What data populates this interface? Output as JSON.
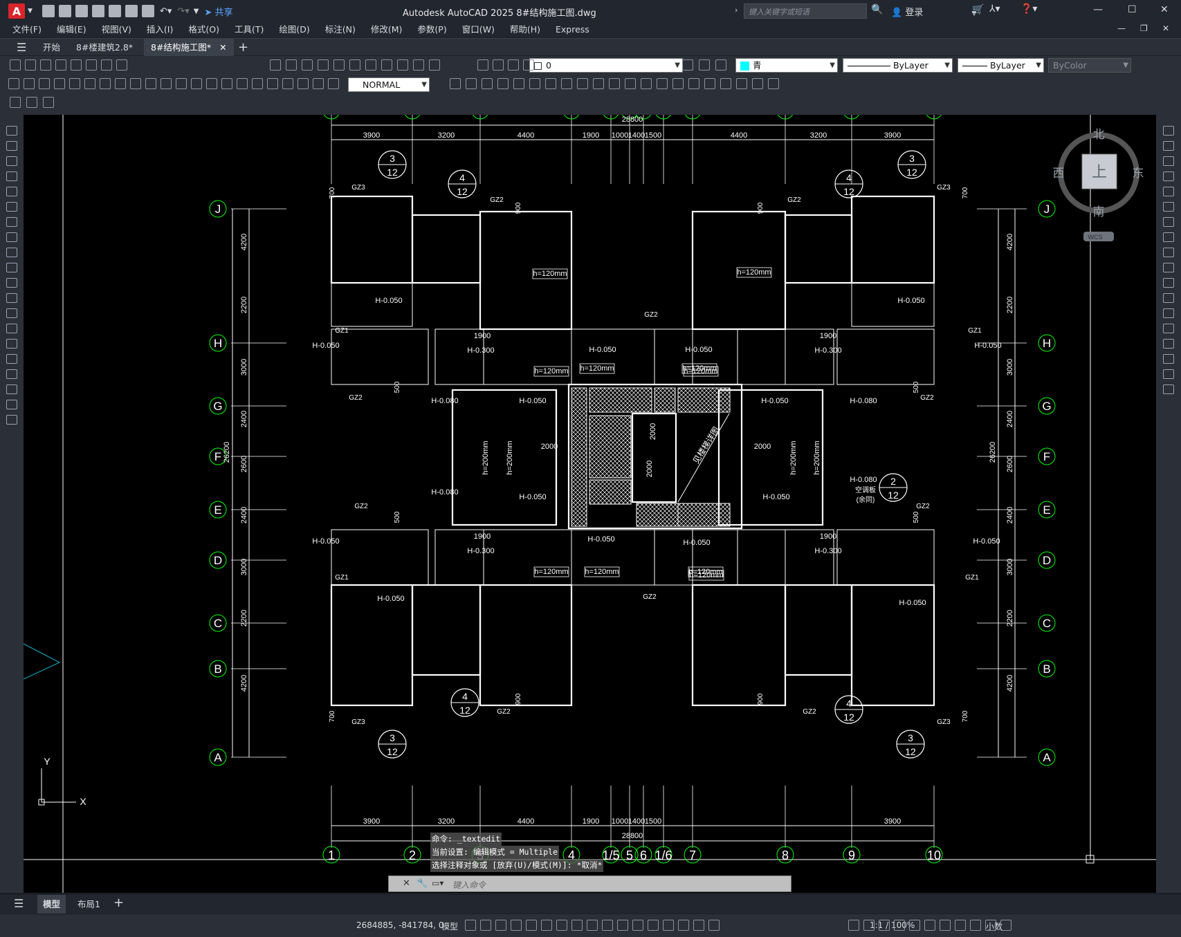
{
  "app": {
    "title": "Autodesk AutoCAD 2025    8#结构施工图.dwg",
    "logo": "A",
    "share_label": "共享",
    "search_placeholder": "键入关键字或短语",
    "login_label": "登录"
  },
  "menu": [
    "文件(F)",
    "编辑(E)",
    "视图(V)",
    "插入(I)",
    "格式(O)",
    "工具(T)",
    "绘图(D)",
    "标注(N)",
    "修改(M)",
    "参数(P)",
    "窗口(W)",
    "帮助(H)",
    "Express"
  ],
  "tabs": [
    {
      "label": "开始"
    },
    {
      "label": "8#楼建筑2.8*"
    },
    {
      "label": "8#结构施工图*"
    }
  ],
  "toolbar": {
    "layer_value": "0",
    "textstyle_value": "NORMAL",
    "color_value": "青",
    "linetype_value": "ByLayer",
    "lineweight_value": "ByLayer",
    "plotstyle_value": "ByColor"
  },
  "viewcube": {
    "north": "北",
    "south": "南",
    "east": "东",
    "west": "西",
    "top": "上",
    "wcs": "WCS"
  },
  "drawing": {
    "grid_v": [
      "1",
      "2",
      "3",
      "4",
      "1/5",
      "5",
      "6",
      "1/6",
      "7",
      "8",
      "9",
      "10"
    ],
    "grid_h": [
      "J",
      "H",
      "G",
      "F",
      "E",
      "D",
      "C",
      "B",
      "A"
    ],
    "top_dims": [
      "3900",
      "3200",
      "4400",
      "1900",
      "1000",
      "1400",
      "1500",
      "4400",
      "3200",
      "3900"
    ],
    "bottom_dims": [
      "3900",
      "3200",
      "4400",
      "1900",
      "1000",
      "1400",
      "1500",
      "3900"
    ],
    "total_width": "28800",
    "total_height": "26200",
    "left_dims": [
      "4200",
      "2200",
      "3000",
      "2400",
      "2600",
      "2400",
      "3000",
      "2200",
      "4200"
    ],
    "slab_labels": [
      "h=120mm",
      "h=200mm",
      "H-0.050",
      "H-0.300",
      "H-0.080",
      "GZ1",
      "GZ2",
      "GZ3",
      "1900",
      "2000",
      "900",
      "700",
      "500",
      "见楼梯详图",
      "空调板",
      "(余同)"
    ],
    "detail_markers": [
      [
        "3",
        "12"
      ],
      [
        "4",
        "12"
      ],
      [
        "2",
        "12"
      ]
    ]
  },
  "command": {
    "history": [
      "命令: _textedit",
      "当前设置: 编辑模式 = Multiple",
      "选择注释对象或 [放弃(U)/模式(M)]: *取消*"
    ],
    "placeholder": "键入命令"
  },
  "layout_tabs": [
    "模型",
    "布局1"
  ],
  "status": {
    "coords": "2684885, -841784, 0",
    "model_label": "模型",
    "scale": "1:1 / 100%",
    "units": "小数"
  },
  "ucs": {
    "x": "X",
    "y": "Y"
  }
}
